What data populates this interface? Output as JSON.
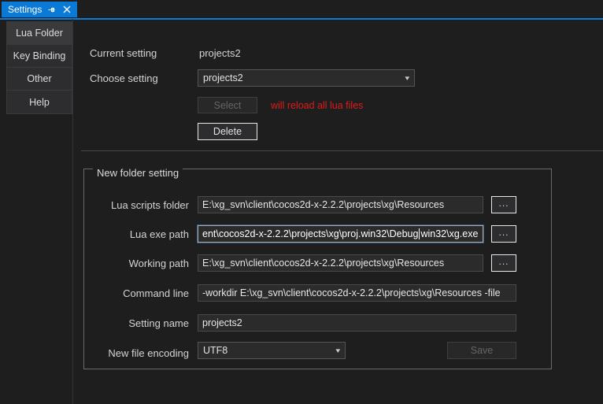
{
  "window": {
    "tab_label": "Settings",
    "pin_icon": "pin-icon",
    "close_icon": "close-icon",
    "accent_color": "#0b7ad6",
    "background_color": "#1e1e1e"
  },
  "sidebar": {
    "items": [
      {
        "label": "Lua Folder",
        "selected": true
      },
      {
        "label": "Key Binding",
        "selected": false
      },
      {
        "label": "Other",
        "selected": false
      },
      {
        "label": "Help",
        "selected": false
      }
    ]
  },
  "top_section": {
    "current_setting_label": "Current setting",
    "current_setting_value": "projects2",
    "choose_setting_label": "Choose setting",
    "choose_setting_value": "projects2",
    "choose_setting_caret": "chevron-down-icon",
    "select_button": "Select",
    "select_button_enabled": false,
    "delete_button": "Delete",
    "warning_text": "will reload all lua files",
    "warning_color": "#e01b1b"
  },
  "group": {
    "title": "New folder setting",
    "browse_button_label": "...",
    "fields": [
      {
        "label": "Lua scripts folder",
        "value": "E:\\xg_svn\\client\\cocos2d-x-2.2.2\\projects\\xg\\Resources",
        "has_browse": true,
        "focused": false
      },
      {
        "label": "Lua exe path",
        "value_before_caret": "ent\\cocos2d-x-2.2.2\\projects\\xg\\proj.win32\\Debug",
        "value_after_caret": "win32\\xg.exe",
        "value": "ent\\cocos2d-x-2.2.2\\projects\\xg\\proj.win32\\Debug\\win32\\xg.exe",
        "has_browse": true,
        "focused": true
      },
      {
        "label": "Working path",
        "value": "E:\\xg_svn\\client\\cocos2d-x-2.2.2\\projects\\xg\\Resources",
        "has_browse": true,
        "focused": false
      },
      {
        "label": "Command line",
        "value": "-workdir  E:\\xg_svn\\client\\cocos2d-x-2.2.2\\projects\\xg\\Resources  -file",
        "has_browse": false,
        "focused": false
      },
      {
        "label": "Setting name",
        "value": "projects2",
        "has_browse": false,
        "focused": false
      }
    ],
    "encoding_label": "New file encoding",
    "encoding_value": "UTF8",
    "encoding_caret": "chevron-down-icon",
    "save_button": "Save",
    "save_button_enabled": false
  }
}
